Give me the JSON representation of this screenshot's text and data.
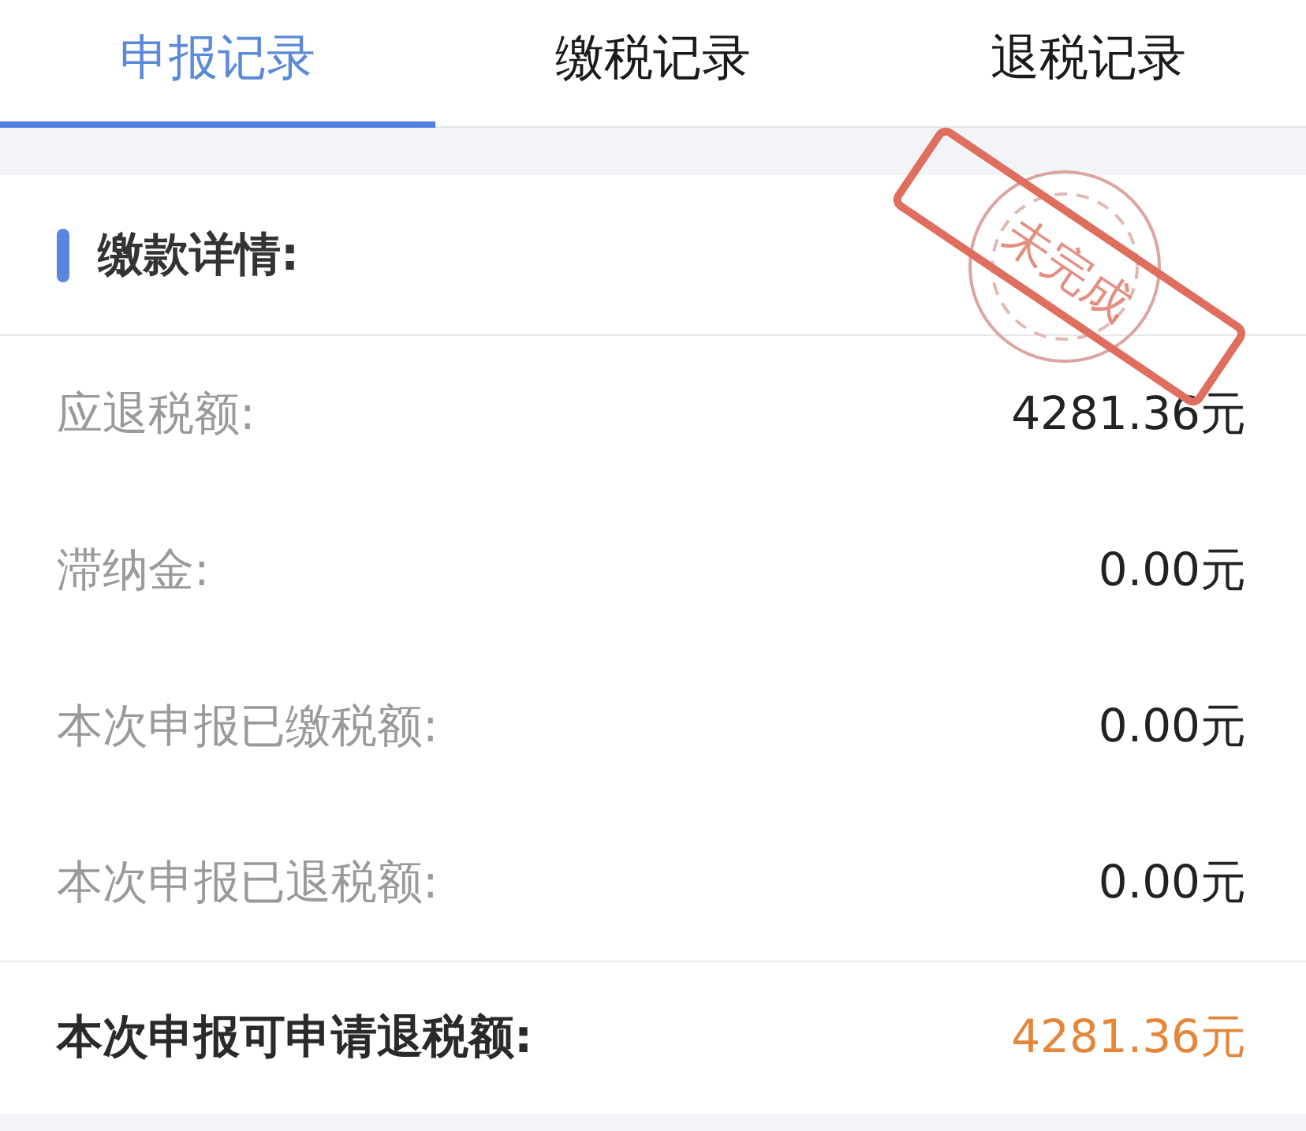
{
  "tabs": [
    {
      "label": "申报记录",
      "selected": true
    },
    {
      "label": "缴税记录",
      "selected": false
    },
    {
      "label": "退税记录",
      "selected": false
    }
  ],
  "section": {
    "title": "缴款详情:"
  },
  "rows": [
    {
      "label": "应退税额:",
      "value": "4281.36元"
    },
    {
      "label": "滞纳金:",
      "value": "0.00元"
    },
    {
      "label": "本次申报已缴税额:",
      "value": "0.00元"
    },
    {
      "label": "本次申报已退税额:",
      "value": "0.00元"
    }
  ],
  "stamp": {
    "text": "未完成"
  },
  "total": {
    "label": "本次申报可申请退税额:",
    "value": "4281.36元"
  }
}
